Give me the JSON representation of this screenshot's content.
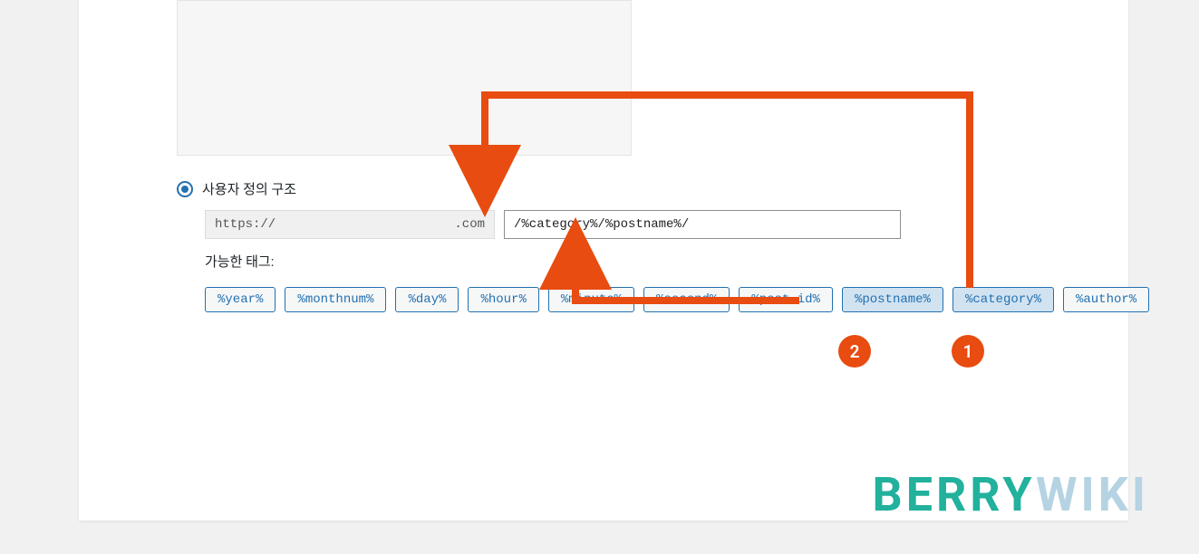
{
  "custom_structure": {
    "label": "사용자 정의 구조",
    "url_scheme": "https://",
    "url_domain": ".com",
    "structure_value": "/%category%/%postname%/"
  },
  "available_tags": {
    "label": "가능한 태그:",
    "items": [
      {
        "label": "%year%",
        "highlight": false
      },
      {
        "label": "%monthnum%",
        "highlight": false
      },
      {
        "label": "%day%",
        "highlight": false
      },
      {
        "label": "%hour%",
        "highlight": false
      },
      {
        "label": "%minute%",
        "highlight": false
      },
      {
        "label": "%second%",
        "highlight": false
      },
      {
        "label": "%post_id%",
        "highlight": false
      },
      {
        "label": "%postname%",
        "highlight": true
      },
      {
        "label": "%category%",
        "highlight": true
      },
      {
        "label": "%author%",
        "highlight": false
      }
    ]
  },
  "annotations": {
    "badge_1": "1",
    "badge_2": "2"
  },
  "watermark": {
    "part1": "BERRY",
    "part2": "WIKI"
  }
}
